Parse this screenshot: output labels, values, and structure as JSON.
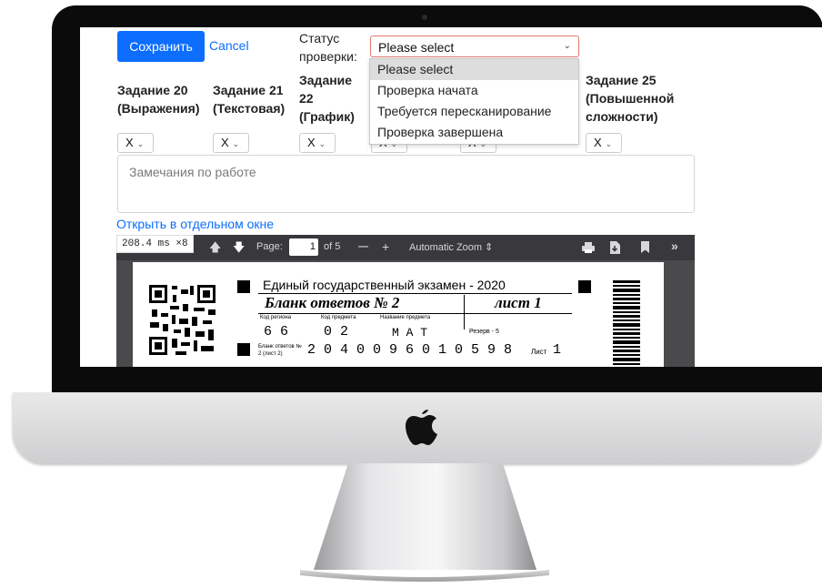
{
  "form": {
    "save_label": "Сохранить",
    "cancel_label": "Cancel",
    "status_label": "Статус проверки:",
    "status_value": "Please select",
    "status_options": [
      "Please select",
      "Проверка начата",
      "Требуется пересканирование",
      "Проверка завершена"
    ],
    "task_headers": [
      "Задание 20 (Выражения)",
      "Задание 21 (Текстовая)",
      "Задание 22 (График)",
      "Задание 25 (Повышенной сложности)"
    ],
    "score_value": "X",
    "notes_placeholder": "Замечания по работе",
    "open_window_label": "Открыть в отдельном окне"
  },
  "pdf": {
    "perf_badge": "208.4 ms ×8",
    "page_label": "Page:",
    "page_value": "1",
    "page_total": "of 5",
    "zoom_minus": "—",
    "zoom_plus": "+",
    "zoom_label": "Automatic Zoom",
    "doc_title": "Единый государственный экзамен - 2020",
    "doc_subtitle": "Бланк ответов № 2",
    "sheet_label": "лист 1",
    "region_label": "Код региона",
    "subject_label": "Код предмета",
    "subject_name_label": "Название предмета",
    "reserve_label": "Резерв - 5",
    "region_code": "6 6",
    "subject_code": "0 2",
    "subject_name": "М А Т",
    "blank_label": "Бланк ответов № 2 (лист 2)",
    "blank_number": "2 0 4 0 0 9 6 0 1 0 5 9 8",
    "list_label": "Лист",
    "list_number": "1"
  },
  "colors": {
    "primary": "#0d6efd",
    "toolbar": "#38383d",
    "select_border": "#e0786c"
  }
}
